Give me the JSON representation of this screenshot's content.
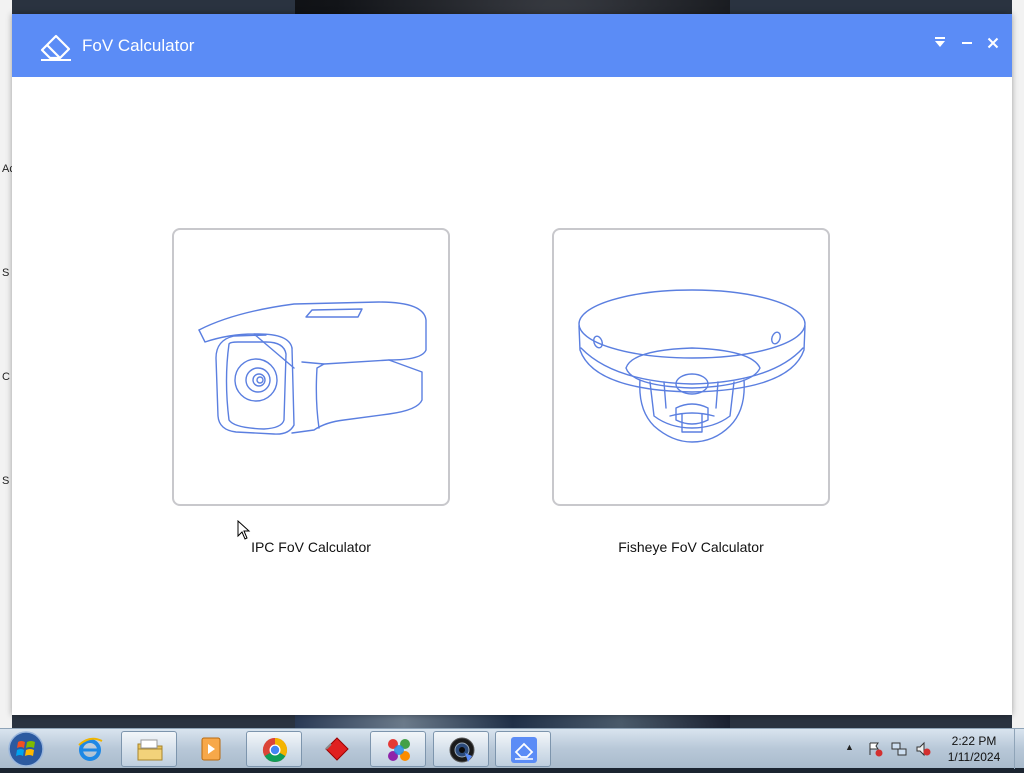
{
  "window": {
    "title": "FoV Calculator"
  },
  "cards": [
    {
      "label": "IPC FoV Calculator",
      "icon": "bullet-camera-icon"
    },
    {
      "label": "Fisheye FoV Calculator",
      "icon": "fisheye-camera-icon"
    }
  ],
  "desktop": {
    "icon_letters": [
      "Ac",
      "S",
      "C",
      "S"
    ]
  },
  "taskbar": {
    "items": [
      "start-orb",
      "internet-explorer",
      "file-explorer",
      "media-player",
      "chrome",
      "red-diamond-app",
      "colorful-app",
      "camera-app",
      "fov-calculator"
    ],
    "clock": {
      "time": "2:22 PM",
      "date": "1/11/2024"
    }
  },
  "colors": {
    "titlebar": "#5b8cf6",
    "line_art": "#5b7fe0"
  }
}
